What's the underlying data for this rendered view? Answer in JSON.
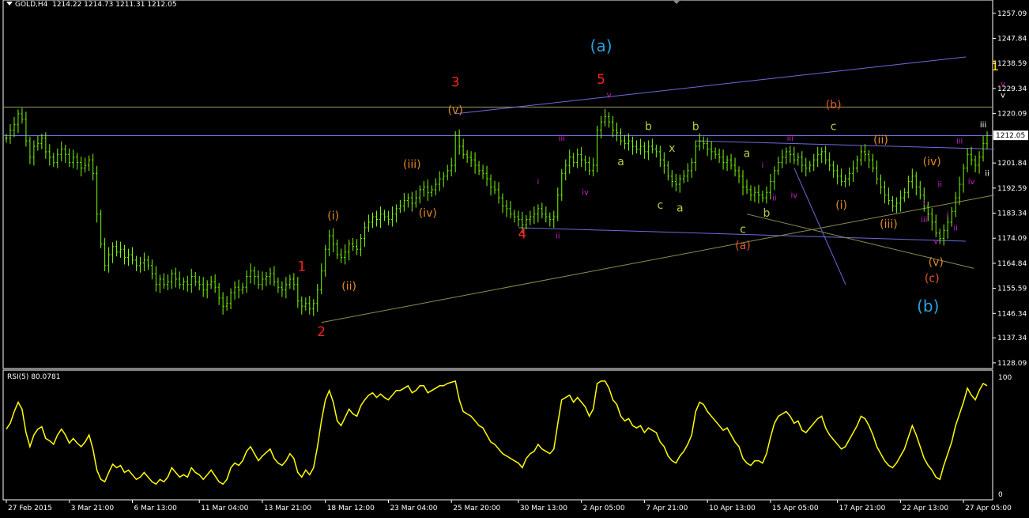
{
  "header": {
    "symbol": "GOLD,H4",
    "ohlc": "1214.22 1214.73 1211.31 1212.05"
  },
  "rsi_header": "RSI(5) 80.0781",
  "colors": {
    "background": "#000000",
    "candles": "#7CFC00",
    "rsi": "#FFFF00",
    "trendline_blue": "#6B6BE0",
    "trendline_olive": "#8C8C50",
    "horizontal_blue": "#8080FF",
    "horizontal_olive": "#9A9A60",
    "price_box": "#FFFFFF"
  },
  "price_axis": {
    "labels": [
      "1257.09",
      "1247.84",
      "1238.59",
      "1229.34",
      "1220.09",
      "1201.84",
      "1192.59",
      "1183.34",
      "1174.09",
      "1164.84",
      "1155.59",
      "1146.34",
      "1137.34",
      "1128.09"
    ],
    "current": "1212.05"
  },
  "rsi_axis": {
    "labels": [
      "100",
      "0"
    ]
  },
  "time_axis": {
    "labels": [
      "27 Feb 2015",
      "3 Mar 21:00",
      "6 Mar 13:00",
      "11 Mar 04:00",
      "13 Mar 21:00",
      "18 Mar 12:00",
      "23 Mar 04:00",
      "25 Mar 20:00",
      "30 Mar 13:00",
      "2 Apr 05:00",
      "7 Apr 21:00",
      "10 Apr 13:00",
      "15 Apr 05:00",
      "17 Apr 21:00",
      "22 Apr 13:00",
      "27 Apr 05:00"
    ]
  },
  "wave_labels": [
    {
      "text": "1",
      "color": "#FF2020",
      "price": 1162,
      "bar": 75
    },
    {
      "text": "2",
      "color": "#FF2020",
      "price": 1138,
      "bar": 80
    },
    {
      "text": "3",
      "color": "#FF2020",
      "price": 1230,
      "bar": 114
    },
    {
      "text": "4",
      "color": "#FF2020",
      "price": 1174,
      "bar": 131
    },
    {
      "text": "5",
      "color": "#FF2020",
      "price": 1231,
      "bar": 151
    },
    {
      "text": "(a)",
      "color": "#29A3E0",
      "price": 1243,
      "bar": 151
    },
    {
      "text": "(b)",
      "color": "#29A3E0",
      "price": 1147,
      "bar": 234
    },
    {
      "text": "1",
      "color": "#FFD700",
      "price": 1236,
      "bar": 251
    },
    {
      "text": "(v)",
      "color": "#E08A2A",
      "price": 1220,
      "bar": 114
    },
    {
      "text": "(iii)",
      "color": "#E08A2A",
      "price": 1200,
      "bar": 103
    },
    {
      "text": "(iv)",
      "color": "#E08A2A",
      "price": 1182,
      "bar": 107
    },
    {
      "text": "(i)",
      "color": "#E08A2A",
      "price": 1181,
      "bar": 83
    },
    {
      "text": "(ii)",
      "color": "#E08A2A",
      "price": 1155,
      "bar": 87
    },
    {
      "text": "(b)",
      "color": "#E05A2A",
      "price": 1222,
      "bar": 210
    },
    {
      "text": "(a)",
      "color": "#E05A2A",
      "price": 1170,
      "bar": 187
    },
    {
      "text": "(c)",
      "color": "#E05A2A",
      "price": 1158,
      "bar": 235
    },
    {
      "text": "(ii)",
      "color": "#E08A2A",
      "price": 1209,
      "bar": 222
    },
    {
      "text": "(i)",
      "color": "#E08A2A",
      "price": 1185,
      "bar": 212
    },
    {
      "text": "(iii)",
      "color": "#E08A2A",
      "price": 1178,
      "bar": 224
    },
    {
      "text": "(iv)",
      "color": "#E08A2A",
      "price": 1201,
      "bar": 235
    },
    {
      "text": "(v)",
      "color": "#E08A2A",
      "price": 1164,
      "bar": 236
    },
    {
      "text": "c",
      "color": "#B0D040",
      "price": 1214,
      "bar": 210
    },
    {
      "text": "b",
      "color": "#B0D040",
      "price": 1214,
      "bar": 163
    },
    {
      "text": "b",
      "color": "#B0D040",
      "price": 1214,
      "bar": 175
    },
    {
      "text": "a",
      "color": "#B0D040",
      "price": 1201,
      "bar": 156
    },
    {
      "text": "x",
      "color": "#B0D040",
      "price": 1206,
      "bar": 169
    },
    {
      "text": "c",
      "color": "#B0D040",
      "price": 1185,
      "bar": 166
    },
    {
      "text": "a",
      "color": "#B0D040",
      "price": 1184,
      "bar": 171
    },
    {
      "text": "a",
      "color": "#B0D040",
      "price": 1204,
      "bar": 188
    },
    {
      "text": "b",
      "color": "#B0D040",
      "price": 1182,
      "bar": 193
    },
    {
      "text": "c",
      "color": "#B0D040",
      "price": 1176,
      "bar": 187
    },
    {
      "text": "iii",
      "color": "#D020D0",
      "price": 1210,
      "bar": 141
    },
    {
      "text": "i",
      "color": "#D020D0",
      "price": 1194,
      "bar": 135
    },
    {
      "text": "iv",
      "color": "#D020D0",
      "price": 1190,
      "bar": 147
    },
    {
      "text": "ii",
      "color": "#D020D0",
      "price": 1174,
      "bar": 140
    },
    {
      "text": "v",
      "color": "#D020D0",
      "price": 1226,
      "bar": 153
    },
    {
      "text": "iii",
      "color": "#D020D0",
      "price": 1210,
      "bar": 199
    },
    {
      "text": "i",
      "color": "#D020D0",
      "price": 1200,
      "bar": 192
    },
    {
      "text": "ii",
      "color": "#D020D0",
      "price": 1188,
      "bar": 195
    },
    {
      "text": "iv",
      "color": "#D020D0",
      "price": 1189,
      "bar": 200
    },
    {
      "text": "iii",
      "color": "#D020D0",
      "price": 1209,
      "bar": 242
    },
    {
      "text": "ii",
      "color": "#D020D0",
      "price": 1193,
      "bar": 237
    },
    {
      "text": "i",
      "color": "#D020D0",
      "price": 1186,
      "bar": 233
    },
    {
      "text": "iii",
      "color": "#D020D0",
      "price": 1180,
      "bar": 233
    },
    {
      "text": "i",
      "color": "#D020D0",
      "price": 1182,
      "bar": 239
    },
    {
      "text": "ii",
      "color": "#D020D0",
      "price": 1177,
      "bar": 241
    },
    {
      "text": "iv",
      "color": "#D020D0",
      "price": 1194,
      "bar": 245
    },
    {
      "text": "v",
      "color": "#D020D0",
      "price": 1172,
      "bar": 236
    },
    {
      "text": "v",
      "color": "#D020D0",
      "price": 1230,
      "bar": 253
    },
    {
      "text": "v",
      "color": "#FFFFFF",
      "price": 1226,
      "bar": 253
    },
    {
      "text": "iii",
      "color": "#FFFFFF",
      "price": 1215,
      "bar": 248
    },
    {
      "text": "ii",
      "color": "#FFFFFF",
      "price": 1197,
      "bar": 249
    }
  ],
  "chart_data": [
    {
      "type": "line",
      "title": "GOLD,H4",
      "series_kind": "ohlc-bars",
      "xlabel": "",
      "ylabel": "",
      "ylim": [
        1126,
        1262
      ],
      "x_ticks": [
        "27 Feb 2015",
        "3 Mar 21:00",
        "6 Mar 13:00",
        "11 Mar 04:00",
        "13 Mar 21:00",
        "18 Mar 12:00",
        "23 Mar 04:00",
        "25 Mar 20:00",
        "30 Mar 13:00",
        "2 Apr 05:00",
        "7 Apr 21:00",
        "10 Apr 13:00",
        "15 Apr 05:00",
        "17 Apr 21:00",
        "22 Apr 13:00",
        "27 Apr 05:00"
      ],
      "close": [
        1211,
        1214,
        1216,
        1220,
        1218,
        1210,
        1204,
        1208,
        1209,
        1211,
        1206,
        1204,
        1202,
        1205,
        1207,
        1205,
        1202,
        1204,
        1202,
        1200,
        1201,
        1203,
        1198,
        1183,
        1172,
        1164,
        1168,
        1171,
        1169,
        1170,
        1167,
        1168,
        1166,
        1164,
        1165,
        1166,
        1164,
        1161,
        1157,
        1159,
        1157,
        1158,
        1161,
        1159,
        1157,
        1158,
        1157,
        1160,
        1158,
        1157,
        1155,
        1157,
        1158,
        1156,
        1152,
        1149,
        1150,
        1154,
        1156,
        1155,
        1156,
        1160,
        1162,
        1160,
        1157,
        1159,
        1160,
        1161,
        1158,
        1156,
        1155,
        1157,
        1159,
        1157,
        1151,
        1149,
        1150,
        1148,
        1150,
        1155,
        1162,
        1170,
        1175,
        1172,
        1168,
        1167,
        1169,
        1172,
        1171,
        1170,
        1174,
        1178,
        1180,
        1182,
        1181,
        1183,
        1182,
        1181,
        1183,
        1185,
        1186,
        1188,
        1189,
        1187,
        1189,
        1192,
        1193,
        1191,
        1192,
        1194,
        1196,
        1197,
        1199,
        1201,
        1212,
        1208,
        1205,
        1204,
        1203,
        1201,
        1199,
        1198,
        1196,
        1193,
        1192,
        1189,
        1186,
        1185,
        1183,
        1182,
        1181,
        1179,
        1181,
        1182,
        1183,
        1185,
        1183,
        1182,
        1181,
        1182,
        1190,
        1198,
        1201,
        1204,
        1202,
        1205,
        1203,
        1202,
        1199,
        1201,
        1214,
        1217,
        1219,
        1217,
        1214,
        1213,
        1210,
        1209,
        1210,
        1208,
        1207,
        1208,
        1206,
        1208,
        1207,
        1206,
        1203,
        1201,
        1197,
        1195,
        1194,
        1196,
        1197,
        1199,
        1202,
        1208,
        1210,
        1209,
        1207,
        1206,
        1205,
        1204,
        1202,
        1203,
        1201,
        1199,
        1197,
        1193,
        1192,
        1190,
        1191,
        1190,
        1189,
        1191,
        1195,
        1199,
        1202,
        1204,
        1206,
        1205,
        1203,
        1204,
        1201,
        1200,
        1201,
        1203,
        1205,
        1206,
        1203,
        1201,
        1199,
        1197,
        1195,
        1196,
        1198,
        1200,
        1203,
        1206,
        1205,
        1203,
        1200,
        1196,
        1193,
        1190,
        1188,
        1186,
        1187,
        1189,
        1191,
        1195,
        1197,
        1193,
        1190,
        1186,
        1183,
        1180,
        1176,
        1174,
        1177,
        1180,
        1184,
        1189,
        1194,
        1200,
        1205,
        1203,
        1201,
        1204,
        1209,
        1212
      ]
    },
    {
      "type": "line",
      "title": "RSI(5) 80.0781",
      "ylim": [
        0,
        100
      ],
      "values": [
        55,
        60,
        70,
        78,
        72,
        52,
        40,
        50,
        55,
        57,
        47,
        45,
        42,
        50,
        55,
        50,
        43,
        47,
        43,
        40,
        44,
        50,
        38,
        20,
        12,
        10,
        18,
        25,
        22,
        24,
        18,
        20,
        16,
        12,
        14,
        18,
        14,
        10,
        8,
        12,
        10,
        14,
        22,
        18,
        14,
        16,
        14,
        22,
        18,
        16,
        12,
        16,
        20,
        15,
        10,
        8,
        12,
        22,
        26,
        24,
        28,
        36,
        40,
        34,
        28,
        32,
        35,
        38,
        30,
        26,
        24,
        28,
        34,
        30,
        18,
        14,
        20,
        16,
        22,
        40,
        62,
        80,
        88,
        78,
        62,
        58,
        65,
        72,
        68,
        66,
        75,
        80,
        84,
        86,
        82,
        85,
        82,
        80,
        84,
        88,
        88,
        90,
        92,
        86,
        88,
        92,
        92,
        86,
        88,
        90,
        92,
        92,
        94,
        95,
        96,
        80,
        70,
        68,
        66,
        62,
        58,
        56,
        50,
        44,
        42,
        38,
        34,
        32,
        30,
        28,
        26,
        22,
        30,
        34,
        36,
        42,
        38,
        36,
        34,
        38,
        60,
        80,
        82,
        84,
        78,
        82,
        78,
        74,
        66,
        72,
        94,
        96,
        96,
        90,
        80,
        76,
        66,
        62,
        64,
        58,
        56,
        58,
        52,
        56,
        54,
        52,
        44,
        40,
        32,
        28,
        26,
        32,
        36,
        42,
        50,
        70,
        78,
        76,
        70,
        66,
        62,
        58,
        54,
        56,
        50,
        44,
        40,
        30,
        26,
        24,
        28,
        28,
        26,
        34,
        48,
        60,
        66,
        68,
        70,
        66,
        60,
        62,
        54,
        52,
        56,
        60,
        64,
        66,
        56,
        50,
        46,
        42,
        38,
        40,
        46,
        52,
        58,
        66,
        64,
        58,
        50,
        40,
        34,
        28,
        24,
        22,
        26,
        32,
        38,
        48,
        58,
        50,
        40,
        30,
        24,
        20,
        14,
        12,
        24,
        34,
        44,
        58,
        68,
        78,
        90,
        84,
        80,
        88,
        94,
        92
      ]
    }
  ]
}
